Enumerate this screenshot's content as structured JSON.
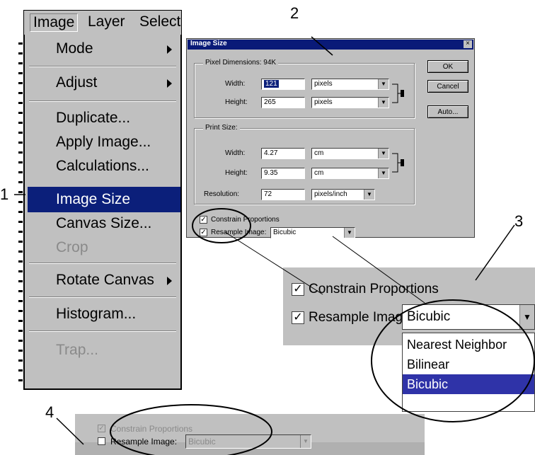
{
  "step_numbers": {
    "one": "1",
    "two": "2",
    "three": "3",
    "four": "4"
  },
  "menubar": {
    "items": [
      "Image",
      "Layer",
      "Select"
    ]
  },
  "menu": {
    "items": [
      {
        "label": "Mode",
        "submenu": true,
        "disabled": false
      },
      {
        "label": "Adjust",
        "submenu": true,
        "disabled": false
      },
      {
        "label": "Duplicate...",
        "submenu": false,
        "disabled": false
      },
      {
        "label": "Apply Image...",
        "submenu": false,
        "disabled": false
      },
      {
        "label": "Calculations...",
        "submenu": false,
        "disabled": false
      },
      {
        "label": "Image Size",
        "submenu": false,
        "disabled": false,
        "highlighted": true
      },
      {
        "label": "Canvas Size...",
        "submenu": false,
        "disabled": false
      },
      {
        "label": "Crop",
        "submenu": false,
        "disabled": true
      },
      {
        "label": "Rotate Canvas",
        "submenu": true,
        "disabled": false
      },
      {
        "label": "Histogram...",
        "submenu": false,
        "disabled": false
      },
      {
        "label": "Trap...",
        "submenu": false,
        "disabled": true
      }
    ]
  },
  "dialog": {
    "title": "Image Size",
    "close_glyph": "×",
    "pixel_dimensions": {
      "label": "Pixel Dimensions: 94K",
      "width_label": "Width:",
      "width_value": "121",
      "width_unit": "pixels",
      "height_label": "Height:",
      "height_value": "265",
      "height_unit": "pixels"
    },
    "print_size": {
      "label": "Print Size:",
      "width_label": "Width:",
      "width_value": "4.27",
      "width_unit": "cm",
      "height_label": "Height:",
      "height_value": "9.35",
      "height_unit": "cm",
      "resolution_label": "Resolution:",
      "resolution_value": "72",
      "resolution_unit": "pixels/inch"
    },
    "constrain_label": "Constrain Proportions",
    "resample_label": "Resample Image:",
    "resample_value": "Bicubic",
    "buttons": {
      "ok": "OK",
      "cancel": "Cancel",
      "auto": "Auto..."
    }
  },
  "zoom3": {
    "constrain_label": "Constrain Proportions",
    "resample_label": "Resample Image:",
    "resample_value": "Bicubic",
    "options": [
      "Nearest Neighbor",
      "Bilinear",
      "Bicubic"
    ],
    "selected_option": "Bicubic"
  },
  "zoom4": {
    "constrain_label": "Constrain Proportions",
    "resample_label": "Resample Image:",
    "resample_value": "Bicubic"
  },
  "check_glyph": "✓",
  "colors": {
    "highlight": "#0b1f7a",
    "titlebar": "#0a1a78",
    "panel": "#c0c0c0",
    "list_selected": "#2f33a8"
  }
}
